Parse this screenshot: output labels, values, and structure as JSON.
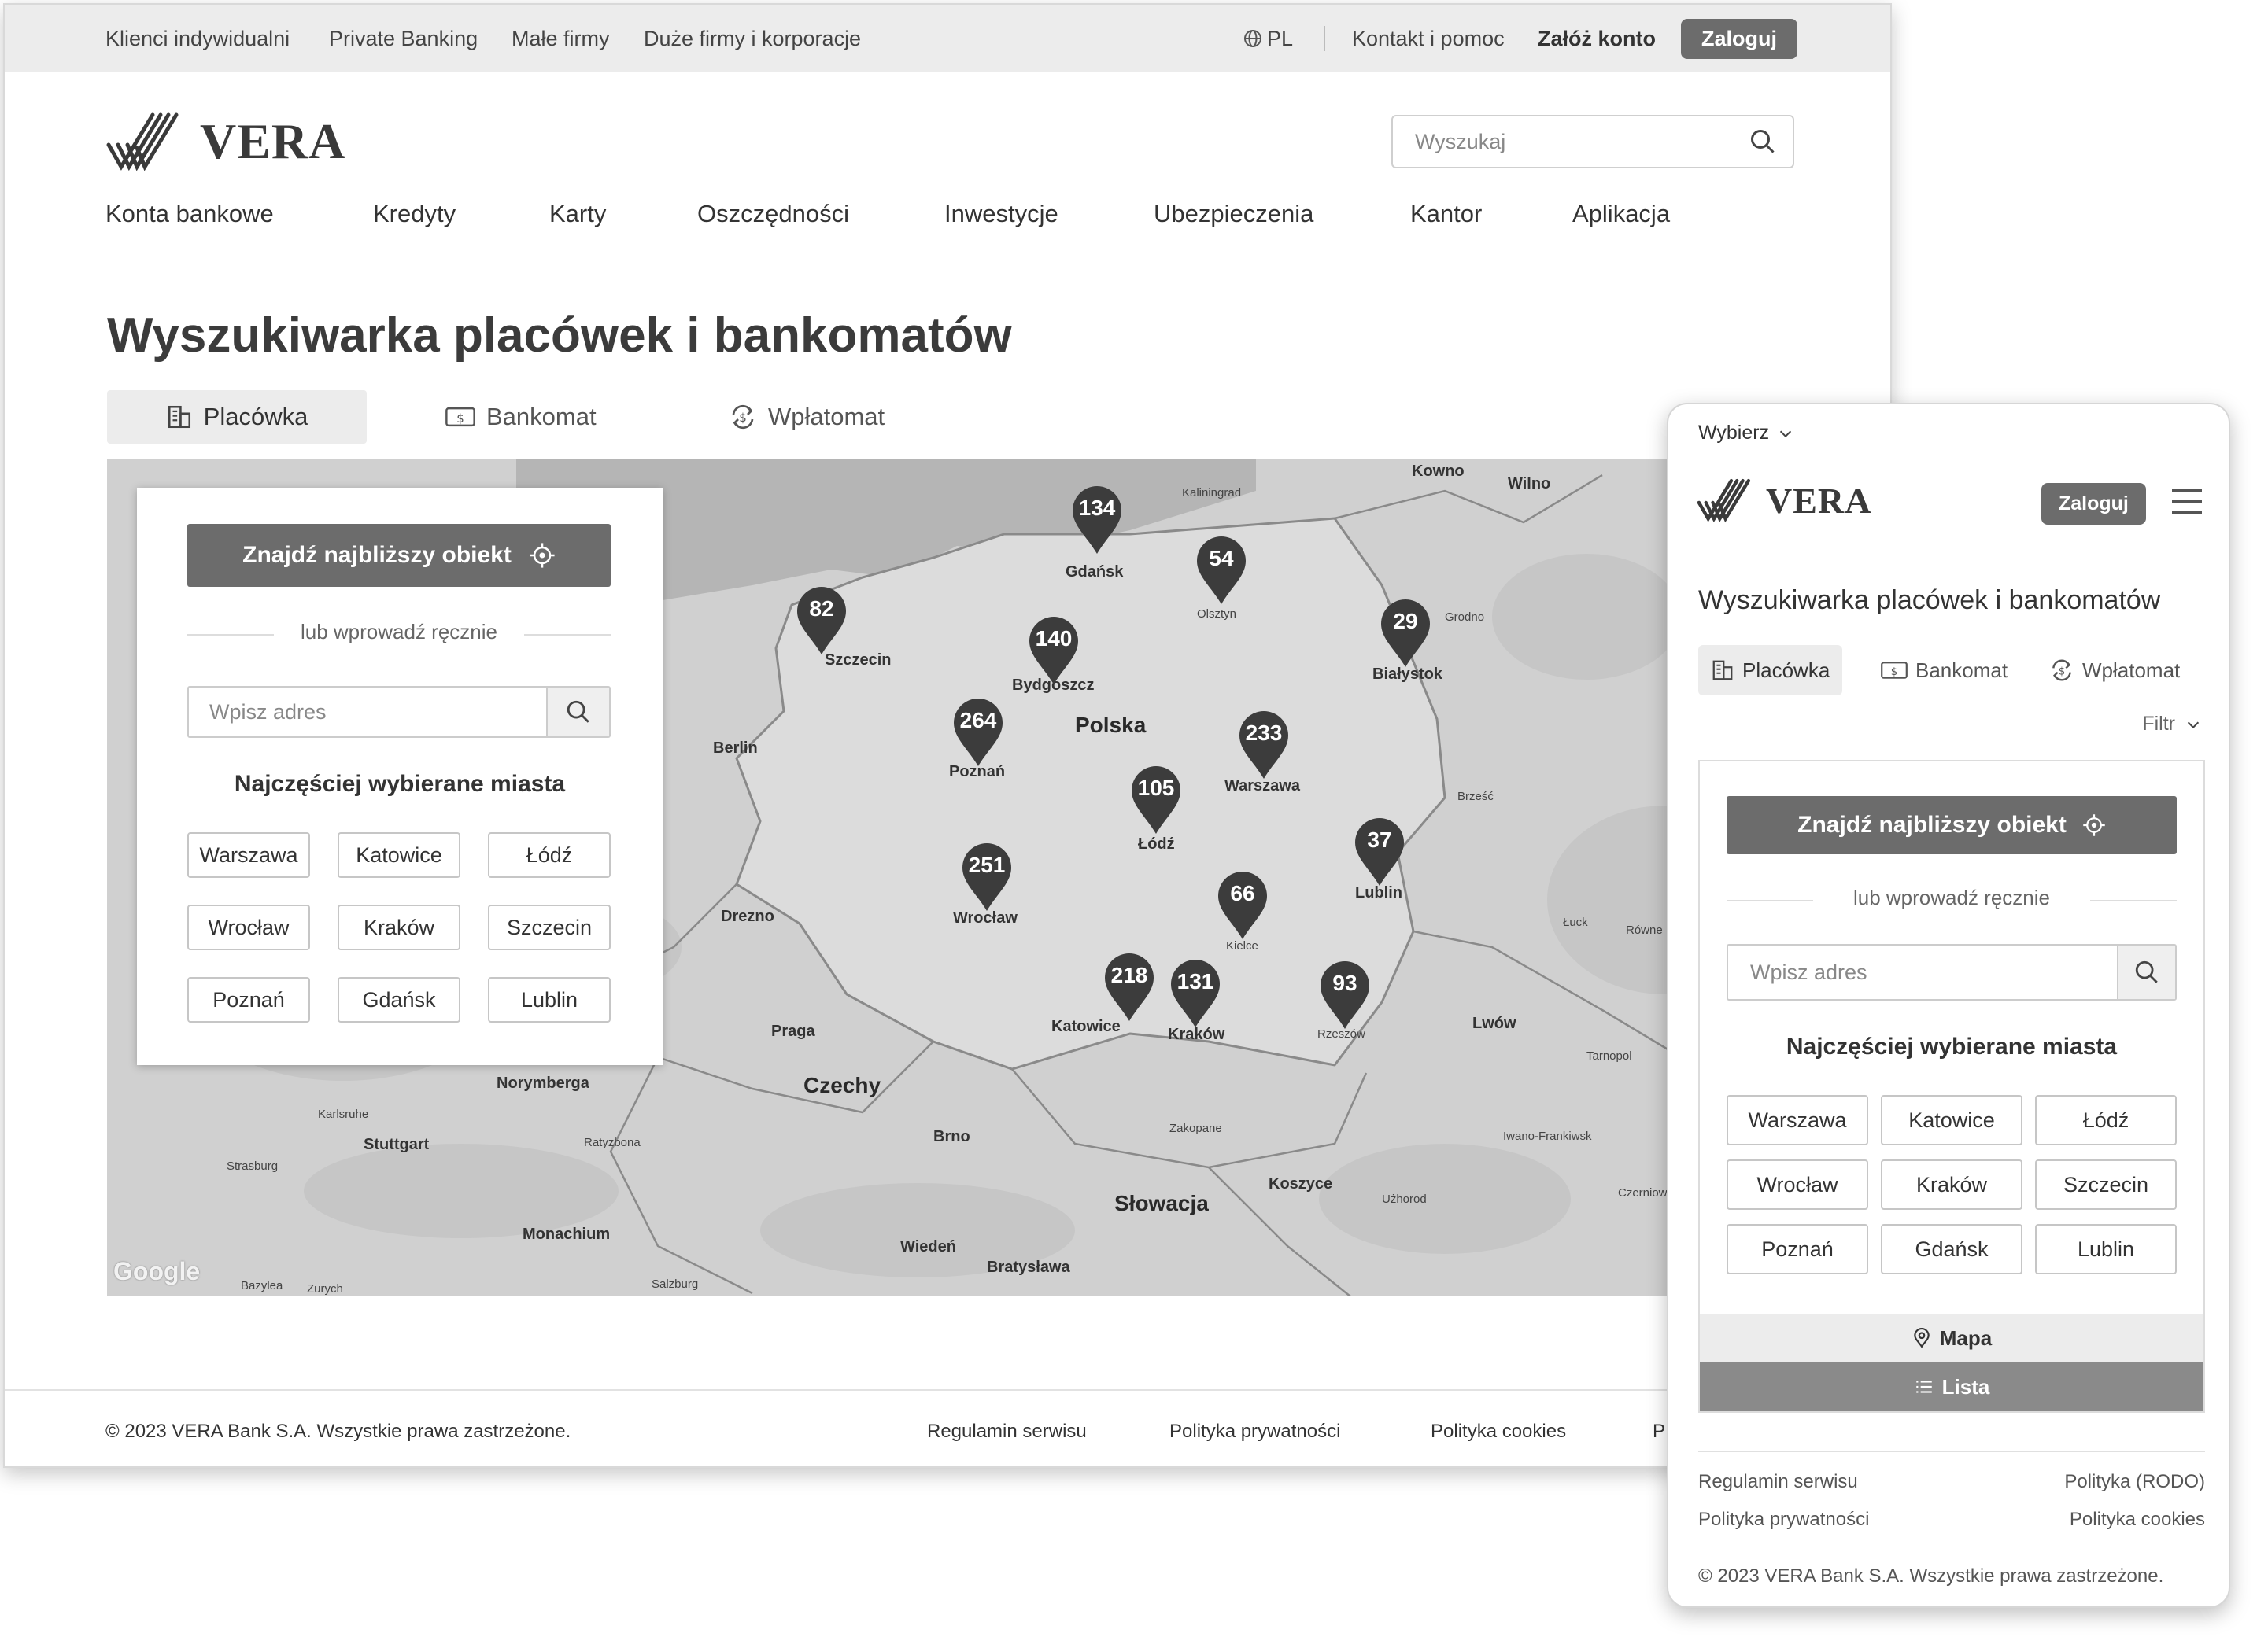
{
  "topbar": {
    "segments": [
      "Klienci indywidualni",
      "Private Banking",
      "Małe firmy",
      "Duże firmy i korporacje"
    ],
    "lang": "PL",
    "contact": "Kontakt i pomoc",
    "register": "Załóż konto",
    "login": "Zaloguj"
  },
  "brand": {
    "name": "VERA"
  },
  "search": {
    "placeholder": "Wyszukaj"
  },
  "nav": [
    "Konta bankowe",
    "Kredyty",
    "Karty",
    "Oszczędności",
    "Inwestycje",
    "Ubezpieczenia",
    "Kantor",
    "Aplikacja"
  ],
  "page": {
    "title": "Wyszukiwarka placówek i bankomatów"
  },
  "tabs": [
    "Placówka",
    "Bankomat",
    "Wpłatomat"
  ],
  "finder": {
    "find_button": "Znajdź najbliższy obiekt",
    "or_text": "lub wprowadź ręcznie",
    "address_placeholder": "Wpisz adres",
    "frequent_title": "Najczęściej wybierane miasta",
    "cities": [
      "Warszawa",
      "Katowice",
      "Łódź",
      "Wrocław",
      "Kraków",
      "Szczecin",
      "Poznań",
      "Gdańsk",
      "Lublin"
    ]
  },
  "map": {
    "country_labels": [
      "Polska",
      "Czechy",
      "Słowacja"
    ],
    "city_labels": [
      "Gdańsk",
      "Szczecin",
      "Bydgoszcz",
      "Poznań",
      "Warszawa",
      "Łódź",
      "Wrocław",
      "Lublin",
      "Kielce",
      "Katowice",
      "Kraków",
      "Rzeszów",
      "Białystok",
      "Olsztyn",
      "Berlin",
      "Drezno",
      "Praga",
      "Norymberga",
      "Stuttgart",
      "Monachium",
      "Brno",
      "Wiedeń",
      "Bratysława",
      "Koszyce",
      "Zakopane",
      "Lwów",
      "Kowno",
      "Wilno",
      "Ratyzbona",
      "Karlsruhe",
      "Strasburg",
      "Salzburg",
      "Zurych",
      "Bazylea",
      "Łuck",
      "Równe",
      "Tarnopol",
      "Iwano-Frankiwsk",
      "Użhorod",
      "Czerniowce",
      "Brześć",
      "Grodno",
      "Kaliningrad"
    ],
    "clusters": [
      {
        "label": "134",
        "city": "Gdańsk"
      },
      {
        "label": "54",
        "city": "Olsztyn"
      },
      {
        "label": "82",
        "city": "Szczecin"
      },
      {
        "label": "140",
        "city": "Bydgoszcz"
      },
      {
        "label": "29",
        "city": "Białystok"
      },
      {
        "label": "264",
        "city": "Poznań"
      },
      {
        "label": "233",
        "city": "Warszawa"
      },
      {
        "label": "105",
        "city": "Łódź"
      },
      {
        "label": "37",
        "city": "Lublin"
      },
      {
        "label": "251",
        "city": "Wrocław"
      },
      {
        "label": "66",
        "city": "Kielce"
      },
      {
        "label": "218",
        "city": "Katowice"
      },
      {
        "label": "131",
        "city": "Kraków"
      },
      {
        "label": "93",
        "city": "Rzeszów"
      }
    ],
    "attribution": "Google"
  },
  "footer": {
    "copyright": "© 2023 VERA Bank S.A. Wszystkie prawa zastrzeżone.",
    "links": [
      "Regulamin serwisu",
      "Polityka prywatności",
      "Polityka cookies",
      "P"
    ]
  },
  "mobile": {
    "select": "Wybierz",
    "login": "Zaloguj",
    "title": "Wyszukiwarka placówek i bankomatów",
    "filter": "Filtr",
    "map_toggle": "Mapa",
    "list_toggle": "Lista",
    "footer_links": [
      "Regulamin serwisu",
      "Polityka (RODO)",
      "Polityka prywatności",
      "Polityka cookies"
    ],
    "copyright": "© 2023 VERA Bank S.A. Wszystkie prawa zastrzeżone."
  }
}
